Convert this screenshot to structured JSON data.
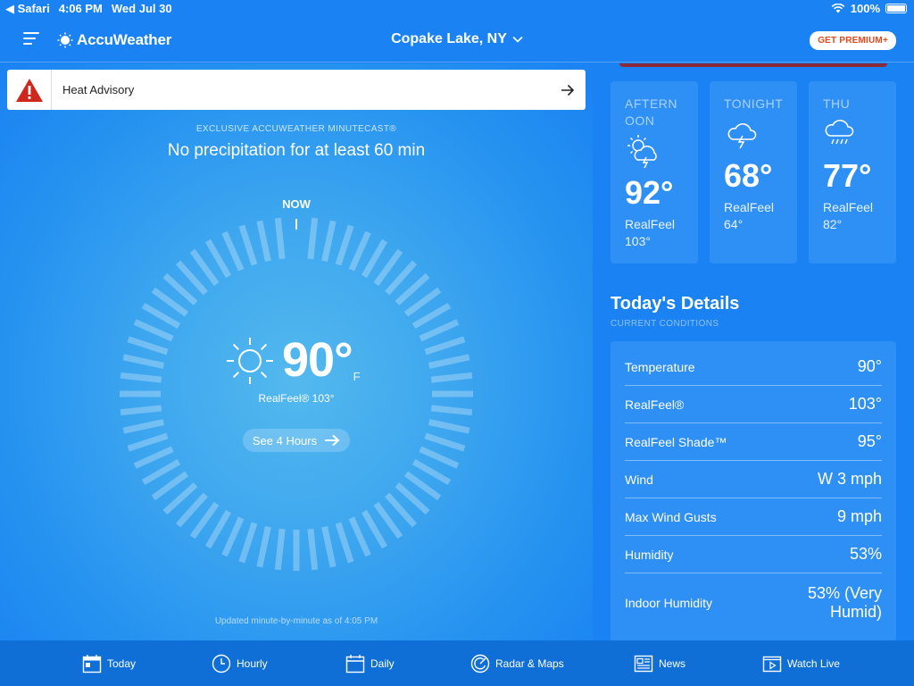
{
  "status_bar": {
    "back_app": "◀ Safari",
    "time": "4:06 PM",
    "date": "Wed Jul 30",
    "battery": "100%"
  },
  "header": {
    "logo_text": "AccuWeather",
    "location": "Copake Lake, NY",
    "premium_label": "GET PREMIUM+"
  },
  "alert": {
    "label": "Heat Advisory"
  },
  "minutecast": {
    "title": "EXCLUSIVE ACCUWEATHER MINUTECAST®",
    "summary": "No precipitation for at least 60 min",
    "now_label": "NOW",
    "temperature": "90°",
    "unit": "F",
    "realfeel": "RealFeel® 103°",
    "see_hours_label": "See 4 Hours",
    "updated": "Updated minute-by-minute as of 4:05 PM"
  },
  "forecast": [
    {
      "period": "AFTERNOON",
      "icon": "sun-cloud-thunder-icon",
      "temp": "92°",
      "realfeel_label": "RealFeel",
      "realfeel_value": "103°"
    },
    {
      "period": "TONIGHT",
      "icon": "cloud-thunder-icon",
      "temp": "68°",
      "realfeel_label": "RealFeel",
      "realfeel_value": "64°"
    },
    {
      "period": "THU",
      "icon": "cloud-rain-icon",
      "temp": "77°",
      "realfeel_label": "RealFeel",
      "realfeel_value": "82°"
    }
  ],
  "details": {
    "title": "Today's Details",
    "subtitle": "CURRENT CONDITIONS",
    "rows": [
      {
        "label": "Temperature",
        "value": "90°"
      },
      {
        "label": "RealFeel®",
        "value": "103°"
      },
      {
        "label": "RealFeel Shade™",
        "value": "95°"
      },
      {
        "label": "Wind",
        "value": "W 3 mph"
      },
      {
        "label": "Max Wind Gusts",
        "value": "9 mph"
      },
      {
        "label": "Humidity",
        "value": "53%"
      },
      {
        "label": "Indoor Humidity",
        "value": "53% (Very Humid)"
      }
    ]
  },
  "bottom_nav": [
    {
      "label": "Today",
      "icon": "calendar-today-icon"
    },
    {
      "label": "Hourly",
      "icon": "clock-icon"
    },
    {
      "label": "Daily",
      "icon": "calendar-icon"
    },
    {
      "label": "Radar & Maps",
      "icon": "radar-icon"
    },
    {
      "label": "News",
      "icon": "newspaper-icon"
    },
    {
      "label": "Watch Live",
      "icon": "play-icon"
    }
  ],
  "colors": {
    "background": "#1a82f2",
    "card": "#2e8ff5",
    "nav": "#0f6fd6",
    "alert_red": "#d0271d",
    "premium_text": "#e8461b"
  }
}
